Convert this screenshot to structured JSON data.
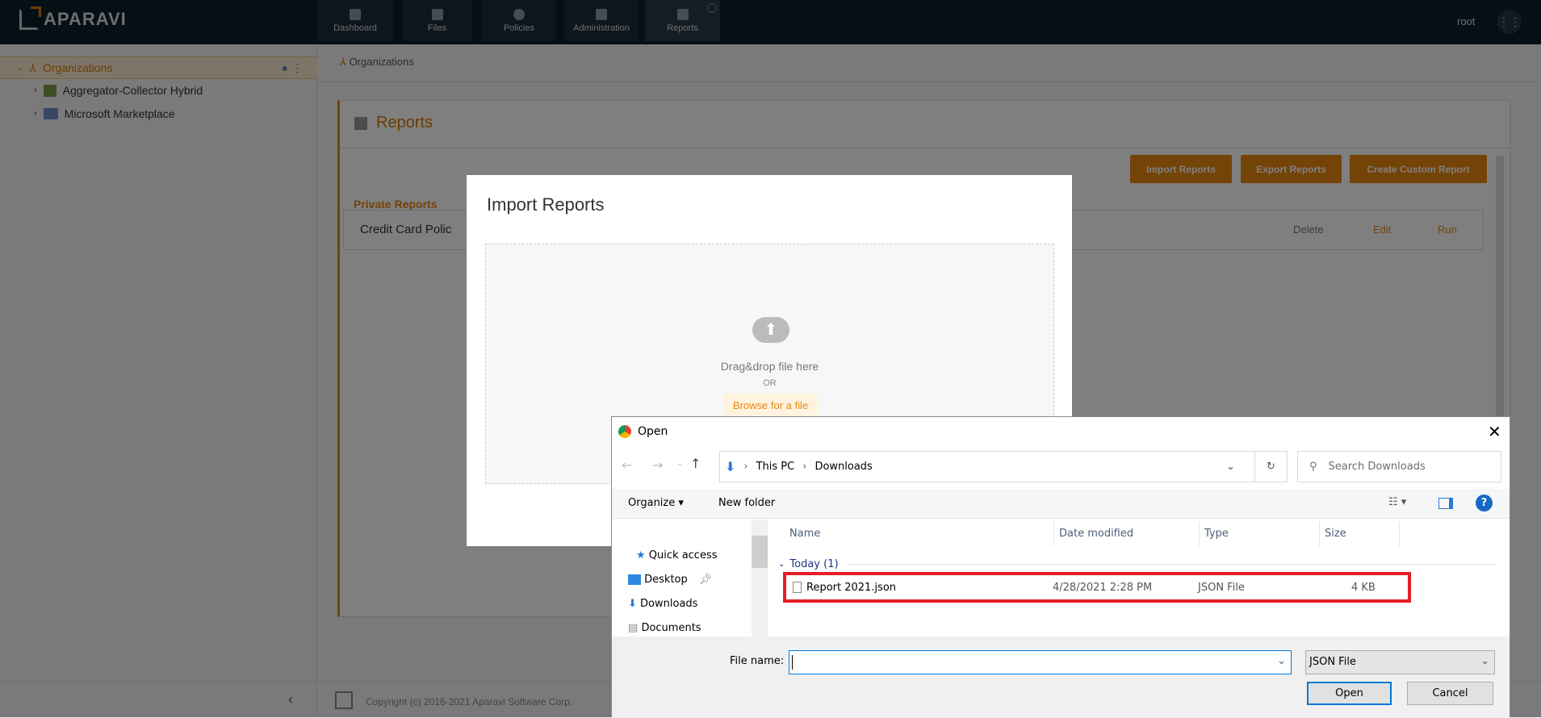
{
  "app": {
    "brand": "APARAVI",
    "user": "root"
  },
  "nav": [
    {
      "label": "Dashboard"
    },
    {
      "label": "Files"
    },
    {
      "label": "Policies"
    },
    {
      "label": "Administration"
    },
    {
      "label": "Reports"
    }
  ],
  "sidebar": {
    "items": [
      {
        "label": "Organizations"
      },
      {
        "label": "Aggregator-Collector Hybrid"
      },
      {
        "label": "Microsoft Marketplace"
      }
    ]
  },
  "breadcrumb": "Organizations",
  "reports": {
    "title": "Reports",
    "buttons": {
      "import": "Import Reports",
      "export": "Export Reports",
      "create": "Create Custom Report"
    },
    "section": "Private Reports",
    "rows": [
      {
        "name": "Credit Card Polic",
        "delete": "Delete",
        "edit": "Edit",
        "run": "Run"
      }
    ]
  },
  "footer": {
    "copyright": "Copyright (c) 2016-2021 Aparavi Software Corp."
  },
  "import_modal": {
    "title": "Import Reports",
    "drag": "Drag&drop file here",
    "or": "OR",
    "browse": "Browse for a file"
  },
  "open_dialog": {
    "title": "Open",
    "path": [
      "This PC",
      "Downloads"
    ],
    "search_placeholder": "Search Downloads",
    "organize": "Organize",
    "new_folder": "New folder",
    "nav_items": [
      {
        "label": "Quick access"
      },
      {
        "label": "Desktop"
      },
      {
        "label": "Downloads"
      },
      {
        "label": "Documents"
      }
    ],
    "columns": [
      "Name",
      "Date modified",
      "Type",
      "Size"
    ],
    "group": "Today (1)",
    "files": [
      {
        "name": "Report 2021.json",
        "date": "4/28/2021 2:28 PM",
        "type": "JSON File",
        "size": "4 KB"
      }
    ],
    "file_name_label": "File name:",
    "file_name_value": "",
    "file_type": "JSON File",
    "open": "Open",
    "cancel": "Cancel"
  }
}
